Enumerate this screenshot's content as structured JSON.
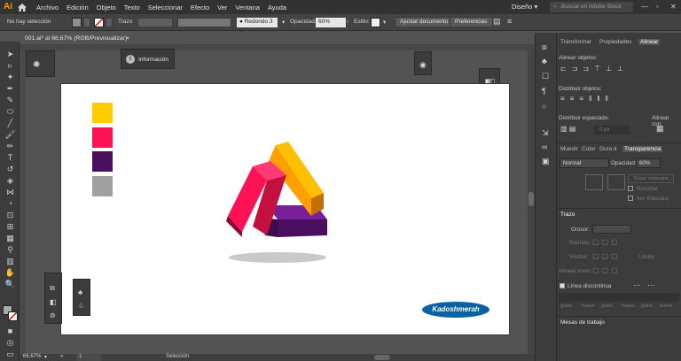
{
  "app": {
    "logo": "Ai",
    "workspace": "Diseño",
    "search_placeholder": "Buscar en Adobe Stock"
  },
  "menu": [
    "Archivo",
    "Edición",
    "Objeto",
    "Texto",
    "Seleccionar",
    "Efecto",
    "Ver",
    "Ventana",
    "Ayuda"
  ],
  "control": {
    "selection": "No hay selección",
    "stroke_label": "Trazo",
    "brush_value": "Redondo 3 ...",
    "opacity_label": "Opacidad:",
    "opacity_value": "60%",
    "style_label": "Estilo:",
    "adjust_button": "Ajustar documento",
    "prefs_button": "Preferencias"
  },
  "document": {
    "tab_title": "001.ai* al 66,67% (RGB/Previsualizar)",
    "close": "×"
  },
  "info_panel": {
    "label": "Información"
  },
  "artboard": {
    "color_swatches": [
      "#ffcc00",
      "#ff1155",
      "#4a0e5e",
      "#a0a0a0"
    ],
    "logo_text": "Kadoshmerah",
    "logo_color": "#0a62a0"
  },
  "panels": {
    "top_tabs": [
      "Transformar",
      "Propiedades",
      "Alinear"
    ],
    "align_objects": "Alinear objetos:",
    "distribute_objects": "Distribuir objetos:",
    "distribute_spacing": "Distribuir espaciado:",
    "align_with": "Alinear con:",
    "spacing_value": "0 px",
    "mid_tabs": [
      "Muestr",
      "Color",
      "Guía d",
      "Transparencia"
    ],
    "blend_mode": "Normal",
    "opacity_label": "Opacidad:",
    "opacity_value": "60%",
    "mask_button": "Crear máscara",
    "clip_label": "Recortar",
    "invert_label": "Inv. máscara",
    "stroke_title": "Trazo",
    "weight_label": "Grosor:",
    "cap_label": "Remate:",
    "corner_label": "Vértice:",
    "limit_label": "Límite:",
    "align_stroke_label": "Alinear trazo:",
    "dashed_label": "Línea discontinua",
    "dash_labels": [
      "guión",
      "hueco",
      "guión",
      "hueco",
      "guión",
      "hueco"
    ],
    "workspaces_label": "Mesas de trabajo"
  },
  "status": {
    "zoom": "66,67%",
    "page": "1",
    "tool": "Selección"
  }
}
